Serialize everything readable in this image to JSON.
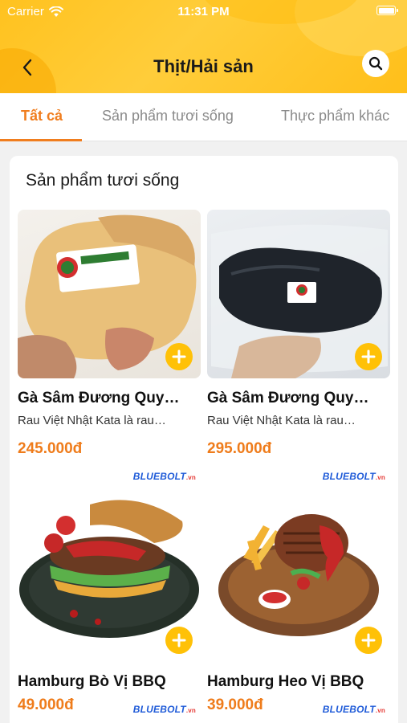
{
  "status_bar": {
    "carrier": "Carrier",
    "time": "11:31 PM"
  },
  "header": {
    "title": "Thịt/Hải sản"
  },
  "tabs": [
    {
      "label": "Tất cả",
      "active": true
    },
    {
      "label": "Sản phẩm tươi sống",
      "active": false
    },
    {
      "label": "Thực phẩm khác",
      "active": false
    }
  ],
  "section": {
    "title": "Sản phẩm tươi sống",
    "products": [
      {
        "name": "Gà Sâm Đương Quy…",
        "desc": "Rau Việt Nhật Kata là rau…",
        "price": "245.000đ",
        "brand": "BLUEBOLT",
        "brand_suffix": ".vn"
      },
      {
        "name": "Gà Sâm Đương Quy…",
        "desc": "Rau Việt Nhật Kata là rau…",
        "price": "295.000đ",
        "brand": "BLUEBOLT",
        "brand_suffix": ".vn"
      },
      {
        "name": "Hamburg Bò Vị BBQ",
        "price": "49.000đ",
        "brand": "BLUEBOLT",
        "brand_suffix": ".vn"
      },
      {
        "name": "Hamburg Heo Vị BBQ",
        "price": "39.000đ",
        "brand": "BLUEBOLT",
        "brand_suffix": ".vn"
      }
    ]
  },
  "colors": {
    "accent": "#f07d1e",
    "header_yellow": "#ffc21f",
    "add_button": "#ffc107",
    "brand_blue": "#1f5bd8"
  }
}
